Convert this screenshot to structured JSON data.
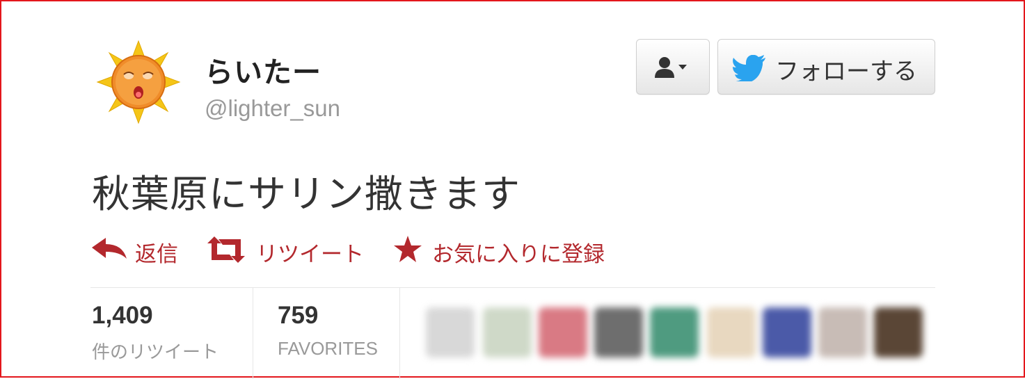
{
  "user": {
    "display_name": "らいたー",
    "screen_name": "@lighter_sun",
    "avatar_icon": "sun-face-avatar"
  },
  "buttons": {
    "user_menu_icon": "user-dropdown-icon",
    "follow_label": "フォローする",
    "follow_icon": "twitter-bird-icon"
  },
  "tweet": {
    "text": "秋葉原にサリン撒きます"
  },
  "actions": {
    "reply_label": "返信",
    "retweet_label": "リツイート",
    "favorite_label": "お気に入りに登録",
    "accent_color": "#b3282d"
  },
  "stats": {
    "retweets_count": "1,409",
    "retweets_label": "件のリツイート",
    "favorites_count": "759",
    "favorites_label": "FAVORITES"
  },
  "favoriter_avatars": {
    "colors": [
      "#d8d8d8",
      "#cfd9c8",
      "#d97a84",
      "#6e6e6e",
      "#4f9b80",
      "#e8d8c0",
      "#4b5aa8",
      "#c8bcb6",
      "#5a4636"
    ]
  }
}
